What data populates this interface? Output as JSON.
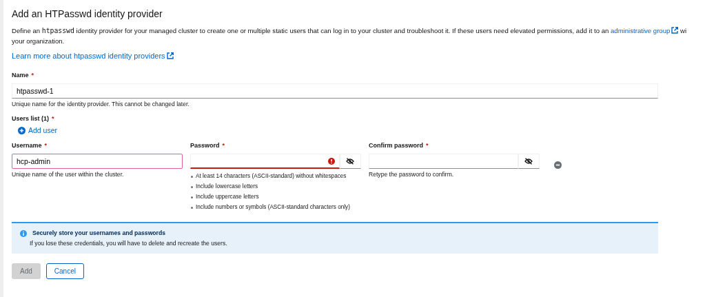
{
  "title": "Add an HTPasswd identity provider",
  "description": {
    "before": "Define an",
    "code": "htpasswd",
    "after": "identity provider for your managed cluster to create one or multiple static users that can log in to your cluster and troubleshoot it. If these users need elevated permissions, add it to an",
    "link": "administrative group",
    "cut": "wi",
    "line2": "your organization."
  },
  "learn_more": "Learn more about htpasswd identity providers",
  "name_field": {
    "label": "Name",
    "required_mark": "*",
    "value": "htpasswd-1",
    "helper": "Unique name for the identity provider. This cannot be changed later."
  },
  "users_list": {
    "label": "Users list (1)",
    "required_mark": "*",
    "add_button": "Add user"
  },
  "user_fields": [
    {
      "kind": "text",
      "label": "Username",
      "required_mark": "*",
      "value": "hcp-admin",
      "focused": true,
      "error": false,
      "helper": "Unique name of the user within the cluster."
    },
    {
      "kind": "password",
      "label": "Password",
      "required_mark": "*",
      "focused": false,
      "error": true,
      "rules": [
        "At least 14 characters (ASCII-standard) without whitespaces",
        "Include lowercase letters",
        "Include uppercase letters",
        "Include numbers or symbols (ASCII-standard characters only)"
      ]
    },
    {
      "kind": "password",
      "label": "Confirm password",
      "required_mark": "*",
      "focused": false,
      "error": false,
      "helper": "Retype the password to confirm."
    }
  ],
  "alert": {
    "title": "Securely store your usernames and passwords",
    "body": "If you lose these credentials, you will have to delete and recreate the users."
  },
  "buttons": [
    {
      "label": "Add",
      "kind": "primary",
      "disabled": true
    },
    {
      "label": "Cancel",
      "kind": "secondary",
      "disabled": false
    }
  ]
}
